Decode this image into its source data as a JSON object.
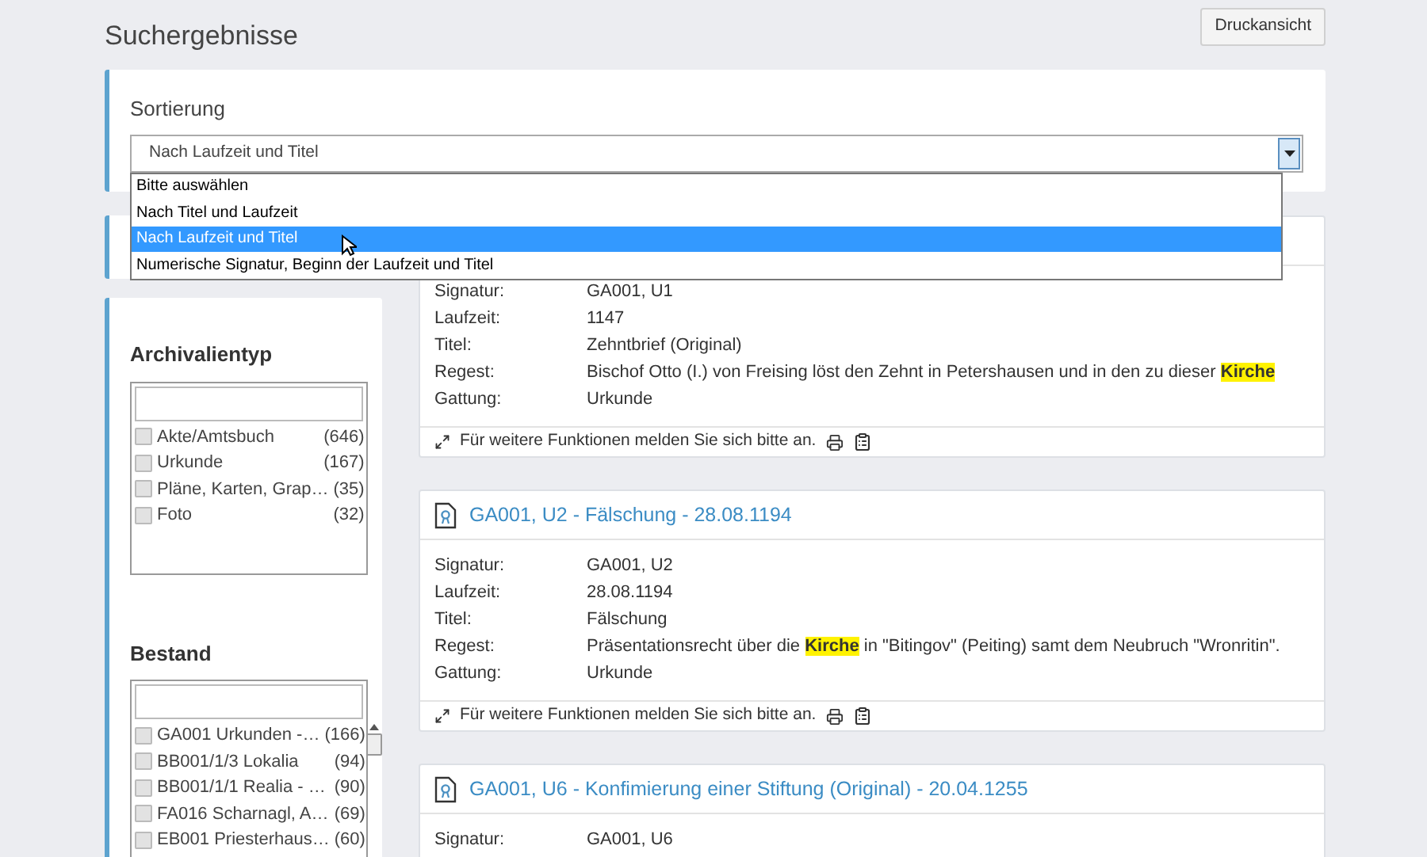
{
  "page": {
    "title": "Suchergebnisse",
    "print_button": "Druckansicht"
  },
  "sort": {
    "label": "Sortierung",
    "value": "Nach Laufzeit und Titel",
    "expanded": true,
    "options": [
      {
        "label": "Bitte auswählen",
        "selected": false
      },
      {
        "label": "Nach Titel und Laufzeit",
        "selected": false
      },
      {
        "label": "Nach Laufzeit und Titel",
        "selected": true
      },
      {
        "label": "Numerische Signatur, Beginn der Laufzeit und Titel",
        "selected": false
      }
    ]
  },
  "facets": [
    {
      "title": "Archivalientyp",
      "scrollbar": false,
      "items": [
        {
          "label": "Akte/Amtsbuch",
          "count": "(646)",
          "checked": false
        },
        {
          "label": "Urkunde",
          "count": "(167)",
          "checked": false
        },
        {
          "label": "Pläne, Karten, Grap…",
          "count": "(35)",
          "checked": false
        },
        {
          "label": "Foto",
          "count": "(32)",
          "checked": false
        }
      ]
    },
    {
      "title": "Bestand",
      "scrollbar": true,
      "items": [
        {
          "label": "GA001 Urkunden -…",
          "count": "(166)",
          "checked": false
        },
        {
          "label": "BB001/1/3 Lokalia",
          "count": "(94)",
          "checked": false
        },
        {
          "label": "BB001/1/1 Realia - …",
          "count": "(90)",
          "checked": false
        },
        {
          "label": "FA016 Scharnagl, A…",
          "count": "(69)",
          "checked": false
        },
        {
          "label": "EB001 Priesterhaus…",
          "count": "(60)",
          "checked": false
        }
      ]
    }
  ],
  "results": [
    {
      "fields": [
        {
          "label": "Signatur:",
          "value": [
            {
              "text": "GA001, U1",
              "highlight": false
            }
          ]
        },
        {
          "label": "Laufzeit:",
          "value": [
            {
              "text": "1147",
              "highlight": false
            }
          ]
        },
        {
          "label": "Titel:",
          "value": [
            {
              "text": "Zehntbrief (Original)",
              "highlight": false
            }
          ]
        },
        {
          "label": "Regest:",
          "value": [
            {
              "text": "Bischof Otto (I.) von Freising löst den Zehnt in Petershausen und in den zu dieser ",
              "highlight": false
            },
            {
              "text": "Kirche",
              "highlight": true
            }
          ]
        },
        {
          "label": "Gattung:",
          "value": [
            {
              "text": "Urkunde",
              "highlight": false
            }
          ]
        }
      ],
      "footer": "Für weitere Funktionen melden Sie sich bitte an."
    },
    {
      "title": "GA001, U2 - Fälschung - 28.08.1194",
      "fields": [
        {
          "label": "Signatur:",
          "value": [
            {
              "text": "GA001, U2",
              "highlight": false
            }
          ]
        },
        {
          "label": "Laufzeit:",
          "value": [
            {
              "text": "28.08.1194",
              "highlight": false
            }
          ]
        },
        {
          "label": "Titel:",
          "value": [
            {
              "text": "Fälschung",
              "highlight": false
            }
          ]
        },
        {
          "label": "Regest:",
          "value": [
            {
              "text": "Präsentationsrecht über die ",
              "highlight": false
            },
            {
              "text": "Kirche",
              "highlight": true
            },
            {
              "text": " in \"Bitingov\" (Peiting) samt dem Neubruch \"Wronritin\".",
              "highlight": false
            }
          ]
        },
        {
          "label": "Gattung:",
          "value": [
            {
              "text": "Urkunde",
              "highlight": false
            }
          ]
        }
      ],
      "footer": "Für weitere Funktionen melden Sie sich bitte an."
    },
    {
      "title": "GA001, U6 - Konfimierung einer Stiftung (Original) - 20.04.1255",
      "fields": [
        {
          "label": "Signatur:",
          "value": [
            {
              "text": "GA001, U6",
              "highlight": false
            }
          ]
        }
      ]
    }
  ]
}
